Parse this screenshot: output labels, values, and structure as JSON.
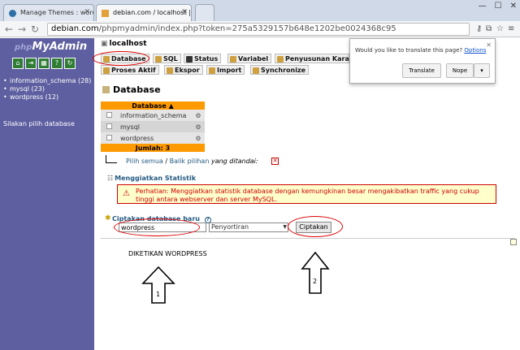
{
  "browser": {
    "tabs": [
      {
        "label": "Manage Themes : wordp"
      },
      {
        "label": "debian.com / localhost | p"
      }
    ],
    "url_host": "debian.com",
    "url_path": "/phpmyadmin/index.php?token=275a5329157b648e1202be0024368c95"
  },
  "translate": {
    "question": "Would you like to translate this page?",
    "options": "Options",
    "translate_btn": "Translate",
    "nope_btn": "Nope"
  },
  "sidebar": {
    "logo_php": "php",
    "logo_main": "MyAdmin",
    "databases": [
      "information_schema (28)",
      "mysql (23)",
      "wordpress (12)"
    ],
    "hint": "Silakan pilih database"
  },
  "main": {
    "server": "localhost",
    "tabs": [
      "Database",
      "SQL",
      "Status",
      "Variabel",
      "Penyusunan Kara",
      "Proses Aktif",
      "Ekspor",
      "Import",
      "Synchronize"
    ],
    "title": "Database",
    "table": {
      "header": "Database",
      "rows": [
        "information_schema",
        "mysql",
        "wordpress"
      ],
      "footer": "Jumlah: 3"
    },
    "select_all": "Pilih semua",
    "unselect_all": "Balik pilihan",
    "with_selected": "yang ditandai:",
    "stats_title": "Menggiatkan Statistik",
    "warning": "Perhatian: Menggiatkan statistik database dengan kemungkinan besar mengakibatkan traffic yang cukup tinggi antara webserver dan server MySQL.",
    "create_title": "Ciptakan database baru",
    "db_name_value": "wordpress",
    "collation_value": "Penyortiran",
    "create_button": "Ciptakan"
  },
  "annotations": {
    "note": "DIKETIKAN WORDPRESS",
    "arrow1": "1",
    "arrow2": "2"
  }
}
